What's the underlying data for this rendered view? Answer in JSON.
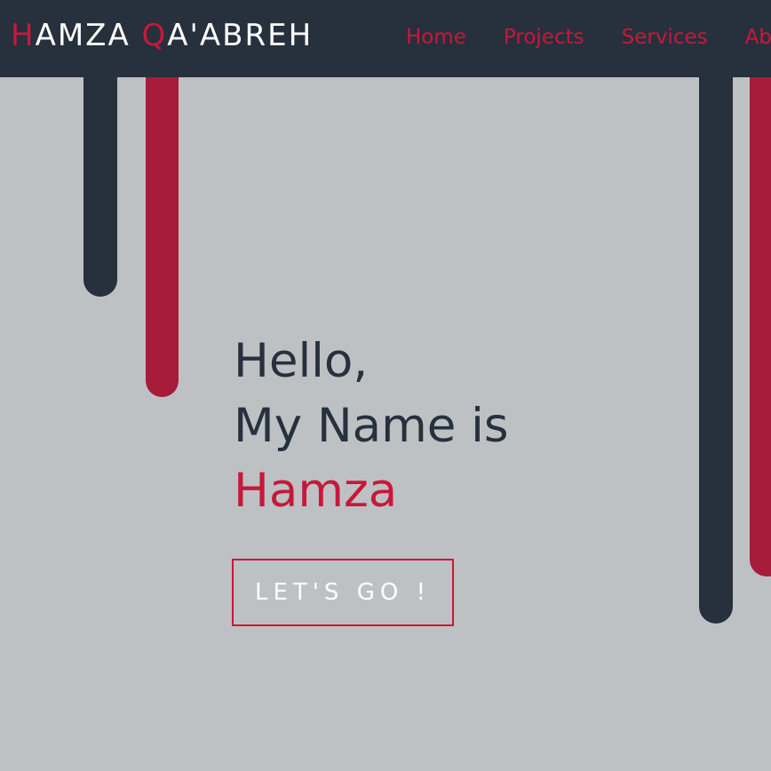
{
  "navbar": {
    "brand": {
      "first_initial": "H",
      "first_rest": "AMZA ",
      "last_initial": "Q",
      "last_rest": "A'ABREH"
    },
    "links": [
      "Home",
      "Projects",
      "Services",
      "About"
    ]
  },
  "hero": {
    "greeting": "Hello,",
    "intro": "My Name is",
    "name": "Hamza",
    "cta_label": "LET'S GO !"
  },
  "colors": {
    "navbar_bg": "#27303d",
    "page_bg": "#bec1c4",
    "accent": "#c8183a",
    "dark_bar": "#27303d",
    "red_bar": "#a71c3a"
  }
}
